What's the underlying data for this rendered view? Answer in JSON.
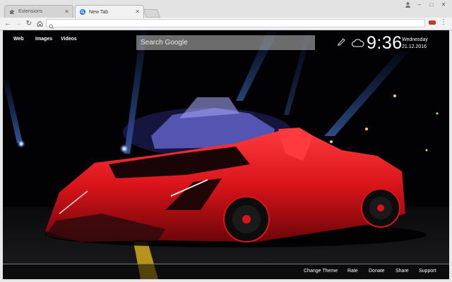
{
  "browser": {
    "tabs": [
      {
        "title": "Extensions",
        "icon": "puzzle-icon"
      },
      {
        "title": "New Tab",
        "icon": "chrome-search-icon"
      }
    ],
    "omnibox_value": ""
  },
  "page": {
    "nav": {
      "web": "Web",
      "images": "Images",
      "videos": "Videos"
    },
    "search_placeholder": "Search Google",
    "weather_icon": "cloud-icon",
    "settings_icon": "pen-icon",
    "time": "9:36",
    "day": "Wednesday",
    "date": "21.12.2016",
    "footer": {
      "change_theme": "Change Theme",
      "rate": "Rate",
      "donate": "Donate",
      "share": "Share",
      "support": "Support"
    }
  },
  "colors": {
    "car_red": "#d9141a",
    "beam_blue": "#3a7bff",
    "background": "#020204"
  }
}
